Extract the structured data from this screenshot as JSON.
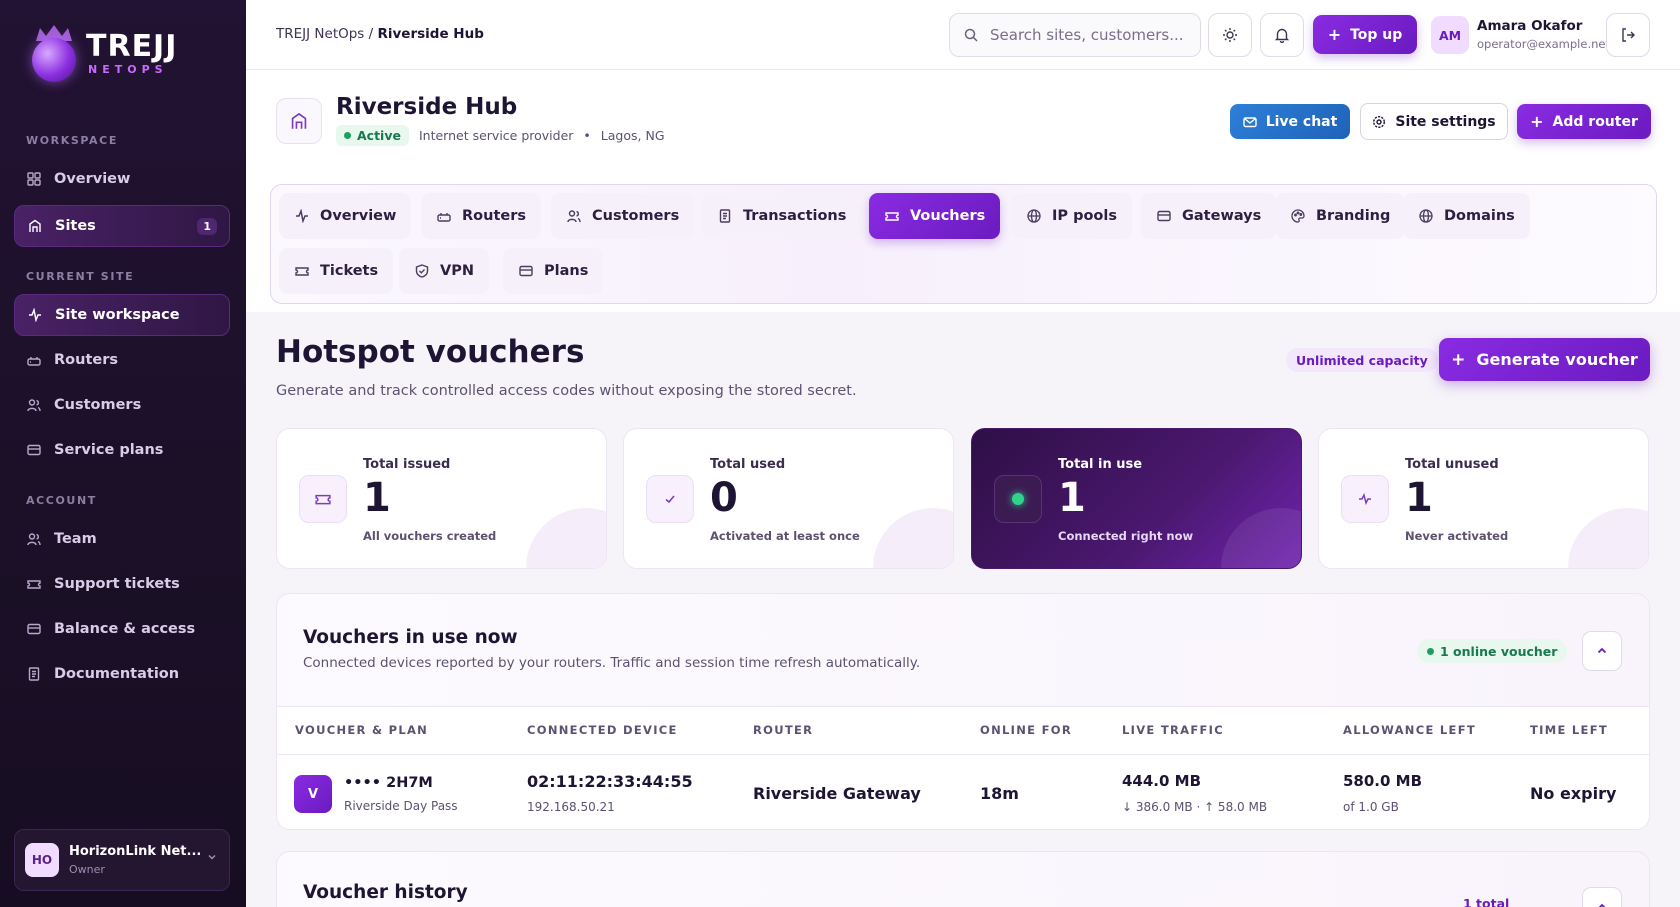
{
  "brand": {
    "name": "TREJJ",
    "sub": "NETOPS"
  },
  "sidebar": {
    "sections": {
      "workspace": "WORKSPACE",
      "current_site": "CURRENT SITE",
      "account": "ACCOUNT"
    },
    "workspace_items": [
      {
        "label": "Overview",
        "icon": "grid-icon"
      },
      {
        "label": "Sites",
        "icon": "building-icon",
        "badge": "1",
        "active": true
      }
    ],
    "site_items": [
      {
        "label": "Site workspace",
        "icon": "activity-icon",
        "active": true
      },
      {
        "label": "Routers",
        "icon": "router-icon"
      },
      {
        "label": "Customers",
        "icon": "users-icon"
      },
      {
        "label": "Service plans",
        "icon": "card-icon"
      }
    ],
    "account_items": [
      {
        "label": "Team",
        "icon": "users-icon"
      },
      {
        "label": "Support tickets",
        "icon": "ticket-icon"
      },
      {
        "label": "Balance & access",
        "icon": "card-icon"
      },
      {
        "label": "Documentation",
        "icon": "document-icon"
      }
    ],
    "org": {
      "initials": "HO",
      "name": "HorizonLink Net...",
      "role": "Owner"
    }
  },
  "topbar": {
    "breadcrumb_root": "TREJJ NetOps /",
    "breadcrumb_current": "Riverside Hub",
    "search_placeholder": "Search sites, customers...",
    "topup_label": "Top up",
    "user": {
      "initials": "AM",
      "name": "Amara Okafor",
      "email": "operator@example.net"
    }
  },
  "site": {
    "name": "Riverside Hub",
    "status": "Active",
    "type": "Internet service provider",
    "separator": "•",
    "location": "Lagos, NG",
    "live_chat_label": "Live chat",
    "settings_label": "Site settings",
    "add_router_label": "Add router"
  },
  "tabs": [
    {
      "label": "Overview",
      "icon": "activity-icon"
    },
    {
      "label": "Routers",
      "icon": "router-icon"
    },
    {
      "label": "Customers",
      "icon": "users-icon"
    },
    {
      "label": "Transactions",
      "icon": "receipt-icon"
    },
    {
      "label": "Vouchers",
      "icon": "ticket-icon",
      "active": true
    },
    {
      "label": "IP pools",
      "icon": "globe-icon"
    },
    {
      "label": "Gateways",
      "icon": "card-icon"
    },
    {
      "label": "Branding",
      "icon": "palette-icon"
    },
    {
      "label": "Domains",
      "icon": "globe-icon"
    },
    {
      "label": "Tickets",
      "icon": "ticket-icon"
    },
    {
      "label": "VPN",
      "icon": "shield-icon"
    },
    {
      "label": "Plans",
      "icon": "card-icon"
    }
  ],
  "vouchers": {
    "title": "Hotspot vouchers",
    "subtitle": "Generate and track controlled access codes without exposing the stored secret.",
    "capacity_badge": "Unlimited capacity",
    "generate_label": "Generate voucher",
    "stats": [
      {
        "label": "Total issued",
        "value": "1",
        "note": "All vouchers created",
        "icon": "ticket-icon"
      },
      {
        "label": "Total used",
        "value": "0",
        "note": "Activated at least once",
        "icon": "check-icon"
      },
      {
        "label": "Total in use",
        "value": "1",
        "note": "Connected right now",
        "icon": "online-dot-icon",
        "dark": true
      },
      {
        "label": "Total unused",
        "value": "1",
        "note": "Never activated",
        "icon": "activity-icon"
      }
    ],
    "in_use": {
      "title": "Vouchers in use now",
      "subtitle": "Connected devices reported by your routers. Traffic and session time refresh automatically.",
      "online_badge": "1 online voucher",
      "columns": [
        "VOUCHER & PLAN",
        "CONNECTED DEVICE",
        "ROUTER",
        "ONLINE FOR",
        "LIVE TRAFFIC",
        "ALLOWANCE LEFT",
        "TIME LEFT"
      ],
      "rows": [
        {
          "avatar": "V",
          "code": "•••• 2H7M",
          "plan": "Riverside Day Pass",
          "mac": "02:11:22:33:44:55",
          "ip": "192.168.50.21",
          "router": "Riverside Gateway",
          "online_for": "18m",
          "traffic": "444.0 MB",
          "traffic_detail": "↓ 386.0 MB · ↑ 58.0 MB",
          "allowance": "580.0 MB",
          "allowance_detail": "of 1.0 GB",
          "time_left": "No expiry"
        }
      ]
    },
    "history": {
      "title": "Voucher history",
      "total": "1 total"
    }
  },
  "colors": {
    "accent": "#7a26d4",
    "sidebar_bg": "#1b1027",
    "success": "#18794e",
    "live_chat": "#2670c8"
  }
}
